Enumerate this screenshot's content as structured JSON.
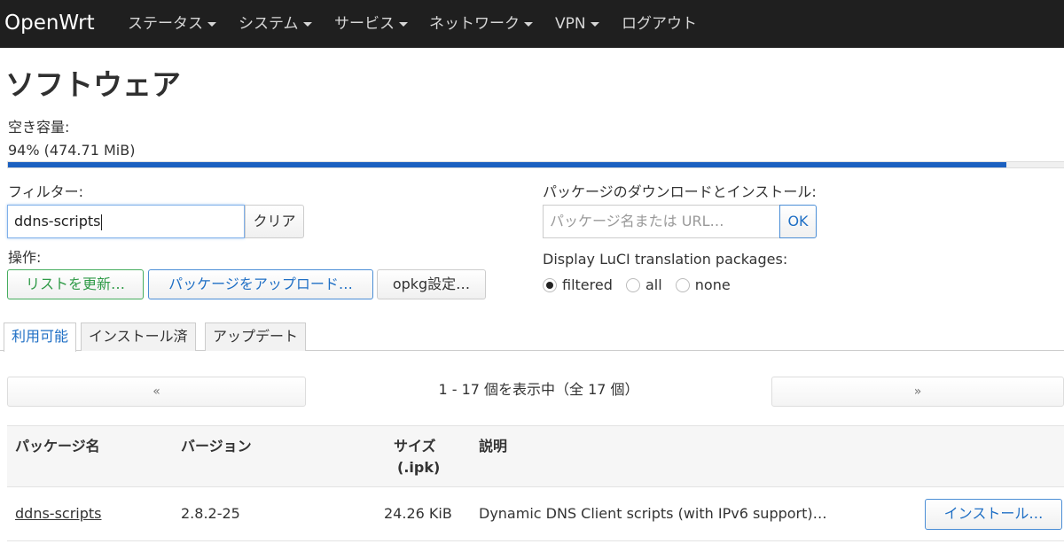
{
  "navbar": {
    "brand": "OpenWrt",
    "items": [
      {
        "label": "ステータス",
        "dropdown": true
      },
      {
        "label": "システム",
        "dropdown": true
      },
      {
        "label": "サービス",
        "dropdown": true
      },
      {
        "label": "ネットワーク",
        "dropdown": true
      },
      {
        "label": "VPN",
        "dropdown": true
      },
      {
        "label": "ログアウト",
        "dropdown": false
      }
    ]
  },
  "page": {
    "title": "ソフトウェア"
  },
  "disk": {
    "label": "空き容量:",
    "value": "94% (474.71 MiB)",
    "used_fraction": 0.94
  },
  "filter": {
    "label": "フィルター:",
    "value": "ddns-scripts",
    "clear_label": "クリア"
  },
  "download": {
    "label": "パッケージのダウンロードとインストール:",
    "placeholder": "パッケージ名または URL…",
    "ok_label": "OK"
  },
  "actions": {
    "label": "操作:",
    "update_label": "リストを更新…",
    "upload_label": "パッケージをアップロード…",
    "config_label": "opkg設定…"
  },
  "translation": {
    "label": "Display LuCI translation packages:",
    "options": [
      {
        "label": "filtered",
        "checked": true
      },
      {
        "label": "all",
        "checked": false
      },
      {
        "label": "none",
        "checked": false
      }
    ]
  },
  "tabs": [
    {
      "label": "利用可能",
      "active": true
    },
    {
      "label": "インストール済",
      "active": false
    },
    {
      "label": "アップデート",
      "active": false
    }
  ],
  "pager": {
    "prev": "«",
    "next": "»",
    "info": "1 - 17 個を表示中（全 17 個）"
  },
  "table": {
    "headers": {
      "name": "パッケージ名",
      "version": "バージョン",
      "size_line1": "サイズ",
      "size_line2": "(.ipk)",
      "description": "説明"
    },
    "rows": [
      {
        "name": "ddns-scripts",
        "version": "2.8.2-25",
        "size": "24.26 KiB",
        "description": "Dynamic DNS Client scripts (with IPv6 support)…",
        "action": "インストール…"
      }
    ]
  },
  "colors": {
    "navbar_bg": "#1f1f1f",
    "progress_fill": "#1b60c0",
    "accent_blue": "#1f6fc5",
    "accent_green": "#2f9a47"
  }
}
